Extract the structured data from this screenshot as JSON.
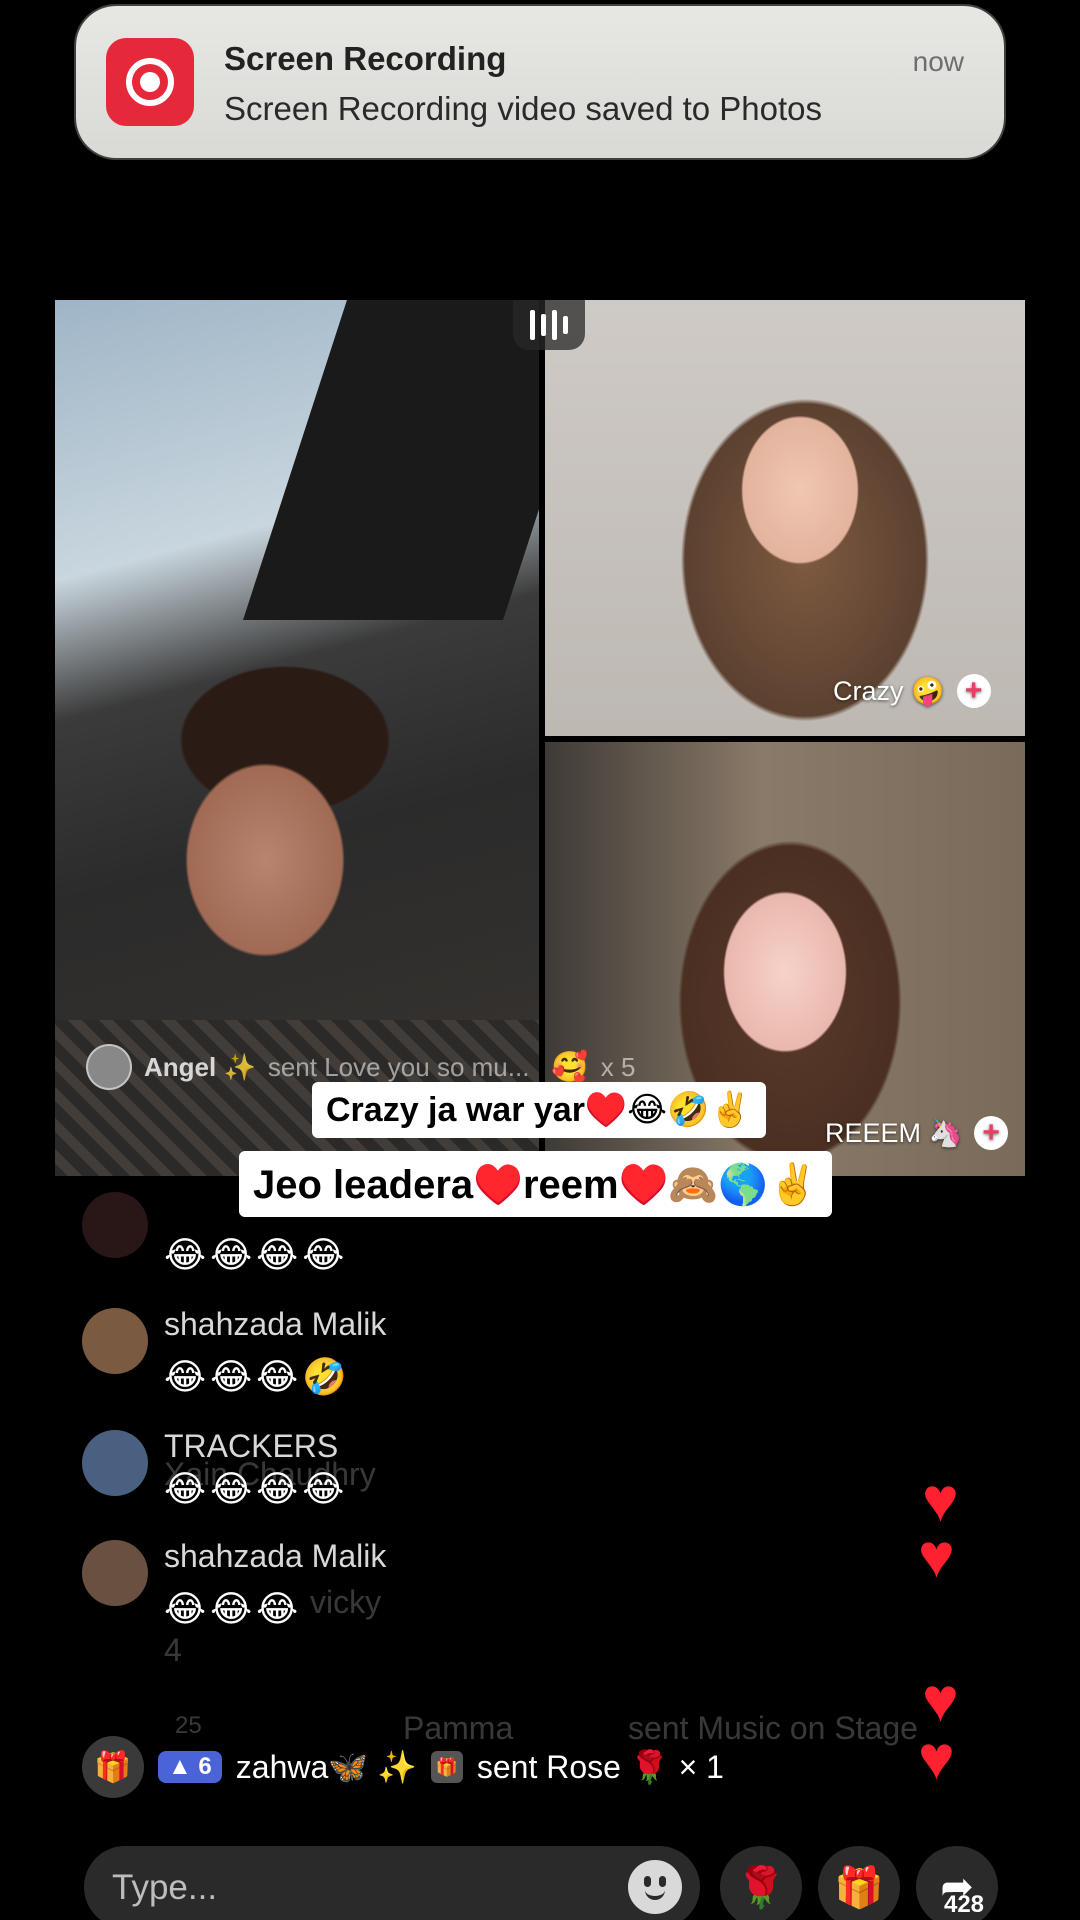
{
  "notification": {
    "app": "Screen Recording",
    "message": "Screen Recording video saved to Photos",
    "time": "now"
  },
  "stage": {
    "guest_top": {
      "name": "Crazy 🤪"
    },
    "guest_bottom": {
      "name": "REEEM 🦄"
    }
  },
  "gift_overlay": {
    "user": "Angel ✨",
    "text": "sent Love you so mu...",
    "count": "x 5"
  },
  "captions": [
    "Crazy ja war yar♥️😂🤣✌️",
    "Jeo leadera♥️reem♥️🙈🌎✌️"
  ],
  "chat": [
    {
      "name": "",
      "message": "😂😂😂😂"
    },
    {
      "name": "shahzada Malik",
      "message": "😂😂😂🤣"
    },
    {
      "name": "TRACKERS",
      "message": "😂😂😂😂"
    },
    {
      "name": "shahzada Malik",
      "message": "😂😂😂"
    }
  ],
  "ghost_chat": {
    "line1": "Xain Chaudhry",
    "line2": "vicky",
    "line3": "4",
    "line4_level": "25",
    "line4_user": "Pamma",
    "line4_text": "sent Music on Stage"
  },
  "gift_event": {
    "level": "6",
    "user": "zahwa🦋 ✨",
    "text": "sent Rose 🌹 × 1"
  },
  "input": {
    "placeholder": "Type..."
  },
  "share_count": "428",
  "colors": {
    "heart": "#ff2030",
    "plus": "#e83e66",
    "record": "#e6293a"
  }
}
